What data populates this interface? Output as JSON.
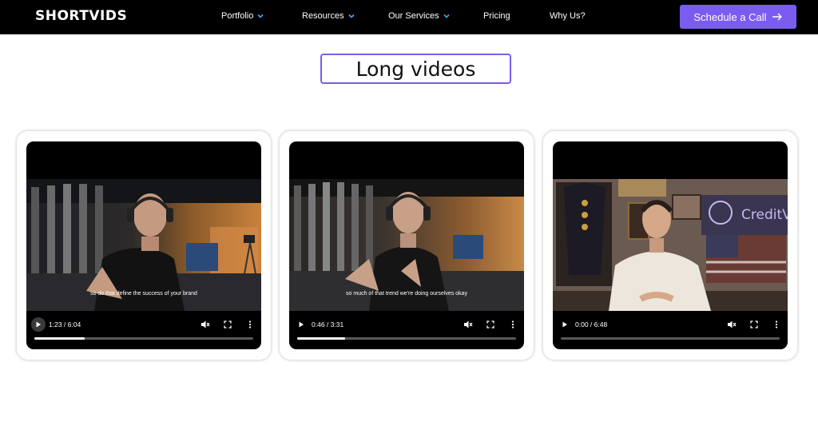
{
  "nav": {
    "logo": "SHORTVIDS",
    "items": [
      {
        "label": "Portfolio",
        "dropdown": true
      },
      {
        "label": "Resources",
        "dropdown": true
      },
      {
        "label": "Our Services",
        "dropdown": true
      },
      {
        "label": "Pricing",
        "dropdown": false
      },
      {
        "label": "Why Us?",
        "dropdown": false
      }
    ],
    "cta": "Schedule a Call",
    "cta_icon": "arrow-right-icon",
    "accent": "#7b5cf0",
    "chevron_color": "#3fa9f5"
  },
  "section": {
    "title": "Long videos"
  },
  "videos": [
    {
      "caption": "so do that define the success of your brand",
      "time": "1:23 / 6:04",
      "progress": 0.23
    },
    {
      "caption": "so much of that trend we're doing ourselves okay",
      "time": "0:46 / 3:31",
      "progress": 0.22
    },
    {
      "caption": "",
      "time": "0:00 / 6:48",
      "progress": 0.0,
      "sign_text": "CreditVe"
    }
  ],
  "controls_icons": [
    "play-icon",
    "mute-icon",
    "fullscreen-icon",
    "more-options-icon"
  ]
}
